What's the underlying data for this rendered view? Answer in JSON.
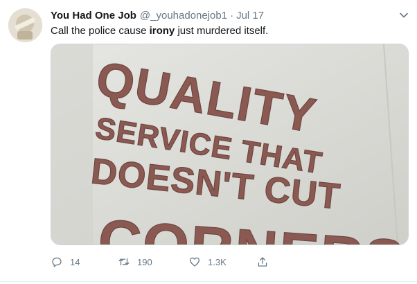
{
  "tweet": {
    "author_name": "You Had One Job",
    "handle": "@_youhadonejob1",
    "separator": "·",
    "date": "Jul 17",
    "text_before": "Call the police cause ",
    "text_bold": "irony",
    "text_after": " just murdered itself.",
    "image_sign": {
      "line1": "QUALITY",
      "line2": "SERVICE THAT",
      "line3": "DOESN'T CUT",
      "line4": "CORNERS"
    },
    "actions": {
      "reply_count": "14",
      "retweet_count": "190",
      "like_count": "1.3K"
    }
  },
  "icons": {
    "more": "chevron-down-icon",
    "reply": "reply-icon",
    "retweet": "retweet-icon",
    "like": "heart-icon",
    "share": "share-icon"
  },
  "colors": {
    "text": "#14171a",
    "secondary": "#657786",
    "sign_letters": "#8a5a52",
    "wall": "#dcdcd8"
  }
}
